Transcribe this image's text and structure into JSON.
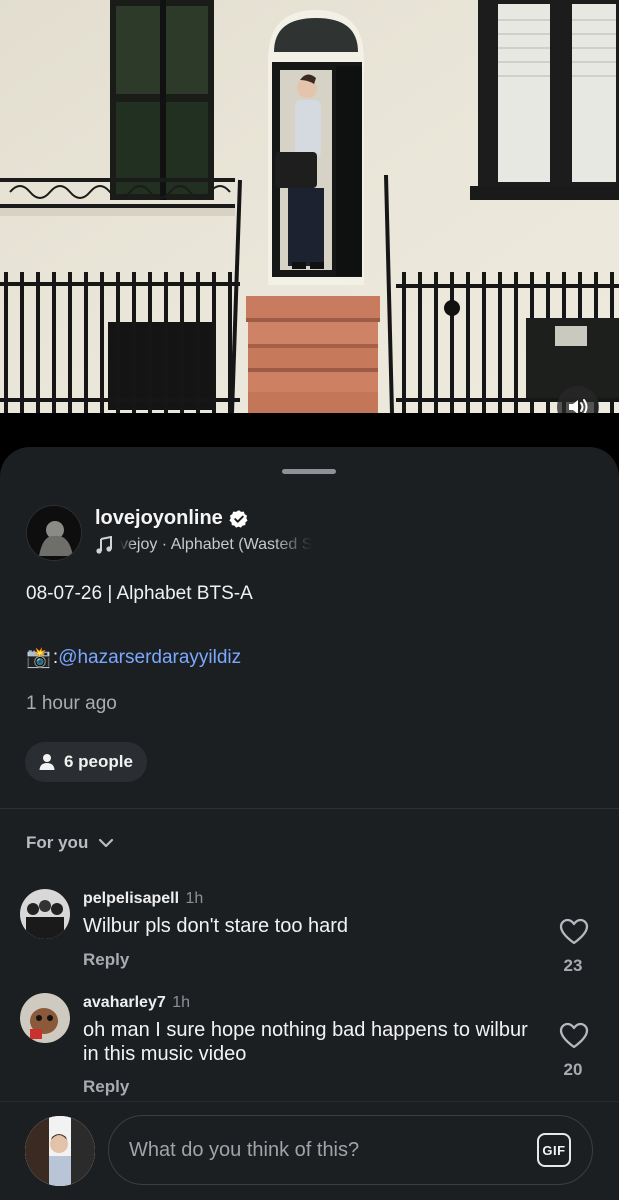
{
  "post": {
    "username": "lovejoyonline",
    "audio": "vejoy · Alphabet (Wasted S",
    "caption_line1": "08-07-26 | Alphabet BTS-A",
    "caption_camera": "📸",
    "caption_colon": ":",
    "caption_mention": "@hazarserdarayyildiz",
    "time_ago": "1 hour ago",
    "people_label": "6 people"
  },
  "comments_header": {
    "filter_label": "For you"
  },
  "comments": [
    {
      "username": "pelpelisapell",
      "time": "1h",
      "text": "Wilbur pls don't stare too hard",
      "reply_label": "Reply",
      "likes": "23"
    },
    {
      "username": "avaharley7",
      "time": "1h",
      "text": "oh man I sure hope nothing bad happens to wilbur in this music video",
      "reply_label": "Reply",
      "likes": "20"
    }
  ],
  "composer": {
    "placeholder": "What do you think of this?",
    "gif_label": "GIF"
  },
  "colors": {
    "sheet_bg": "#1c1f22",
    "mention": "#7aa8ff",
    "verified": "#ffffff"
  },
  "icons": [
    "speaker-icon",
    "verified-badge-icon",
    "music-note-icon",
    "person-icon",
    "chevron-down-icon",
    "heart-icon",
    "gif-icon"
  ]
}
